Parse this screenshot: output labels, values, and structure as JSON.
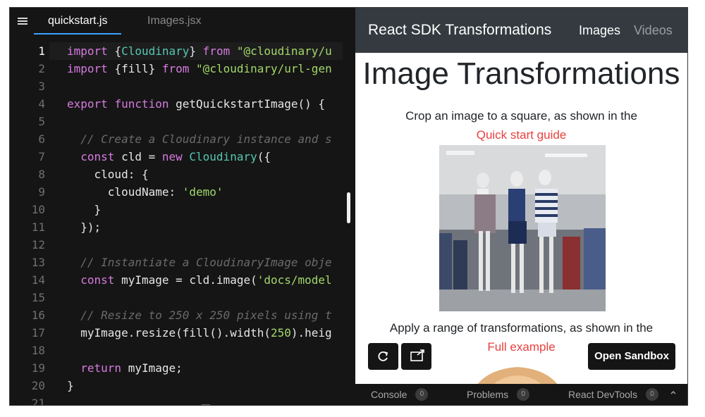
{
  "editor": {
    "tabs": [
      {
        "label": "quickstart.js",
        "active": true
      },
      {
        "label": "Images.jsx",
        "active": false
      }
    ],
    "menu_icon": "hamburger-icon",
    "current_line": 1,
    "lines": [
      {
        "num": "1",
        "segs": [
          {
            "t": "import ",
            "c": "kw"
          },
          {
            "t": "{",
            "c": ""
          },
          {
            "t": "Cloudinary",
            "c": "cls"
          },
          {
            "t": "} ",
            "c": ""
          },
          {
            "t": "from ",
            "c": "kw"
          },
          {
            "t": "\"@cloudinary/u",
            "c": "str"
          }
        ]
      },
      {
        "num": "2",
        "segs": [
          {
            "t": "import ",
            "c": "kw"
          },
          {
            "t": "{fill} ",
            "c": ""
          },
          {
            "t": "from ",
            "c": "kw"
          },
          {
            "t": "\"@cloudinary/url-gen",
            "c": "str"
          }
        ]
      },
      {
        "num": "3",
        "segs": []
      },
      {
        "num": "4",
        "segs": [
          {
            "t": "export ",
            "c": "kw"
          },
          {
            "t": "function ",
            "c": "kw"
          },
          {
            "t": "getQuickstartImage() {",
            "c": ""
          }
        ]
      },
      {
        "num": "5",
        "segs": []
      },
      {
        "num": "6",
        "segs": [
          {
            "t": "  // Create a Cloudinary instance and s",
            "c": "com"
          }
        ]
      },
      {
        "num": "7",
        "segs": [
          {
            "t": "  ",
            "c": ""
          },
          {
            "t": "const ",
            "c": "kw"
          },
          {
            "t": "cld = ",
            "c": ""
          },
          {
            "t": "new ",
            "c": "kw"
          },
          {
            "t": "Cloudinary",
            "c": "cls"
          },
          {
            "t": "({",
            "c": ""
          }
        ]
      },
      {
        "num": "8",
        "segs": [
          {
            "t": "    cloud: {",
            "c": ""
          }
        ]
      },
      {
        "num": "9",
        "segs": [
          {
            "t": "      cloudName: ",
            "c": ""
          },
          {
            "t": "'demo'",
            "c": "str"
          }
        ]
      },
      {
        "num": "10",
        "segs": [
          {
            "t": "    }",
            "c": ""
          }
        ]
      },
      {
        "num": "11",
        "segs": [
          {
            "t": "  });",
            "c": ""
          }
        ]
      },
      {
        "num": "12",
        "segs": []
      },
      {
        "num": "13",
        "segs": [
          {
            "t": "  // Instantiate a CloudinaryImage obje",
            "c": "com"
          }
        ]
      },
      {
        "num": "14",
        "segs": [
          {
            "t": "  ",
            "c": ""
          },
          {
            "t": "const ",
            "c": "kw"
          },
          {
            "t": "myImage = cld.image(",
            "c": ""
          },
          {
            "t": "'docs/model",
            "c": "str"
          }
        ]
      },
      {
        "num": "15",
        "segs": []
      },
      {
        "num": "16",
        "segs": [
          {
            "t": "  // Resize to 250 x 250 pixels using t",
            "c": "com"
          }
        ]
      },
      {
        "num": "17",
        "segs": [
          {
            "t": "  myImage.resize(fill().width(",
            "c": ""
          },
          {
            "t": "250",
            "c": "str"
          },
          {
            "t": ").heig",
            "c": ""
          }
        ]
      },
      {
        "num": "18",
        "segs": []
      },
      {
        "num": "19",
        "segs": [
          {
            "t": "  ",
            "c": ""
          },
          {
            "t": "return ",
            "c": "kw"
          },
          {
            "t": "myImage;",
            "c": ""
          }
        ]
      },
      {
        "num": "20",
        "segs": [
          {
            "t": "}",
            "c": ""
          }
        ]
      },
      {
        "num": "21",
        "segs": []
      }
    ]
  },
  "preview": {
    "brand": "React SDK Transformations",
    "nav": {
      "images": "Images",
      "videos": "Videos"
    },
    "heading": "Image Transformations",
    "para1": "Crop an image to a square, as shown in the",
    "link1": "Quick start guide",
    "para2": "Apply a range of transformations, as shown in the",
    "link2": "Full example",
    "open_sandbox": "Open Sandbox",
    "refresh_icon": "refresh-icon",
    "external_icon": "open-external-icon"
  },
  "bottombar": {
    "console": {
      "label": "Console",
      "count": "0"
    },
    "problems": {
      "label": "Problems",
      "count": "0"
    },
    "devtools": {
      "label": "React DevTools",
      "count": "0"
    }
  },
  "colors": {
    "editor_bg": "#151515",
    "keyword": "#d77be0",
    "class": "#56c7b3",
    "string": "#a2d86a",
    "link": "#e8403f",
    "navbar": "#343a40"
  }
}
